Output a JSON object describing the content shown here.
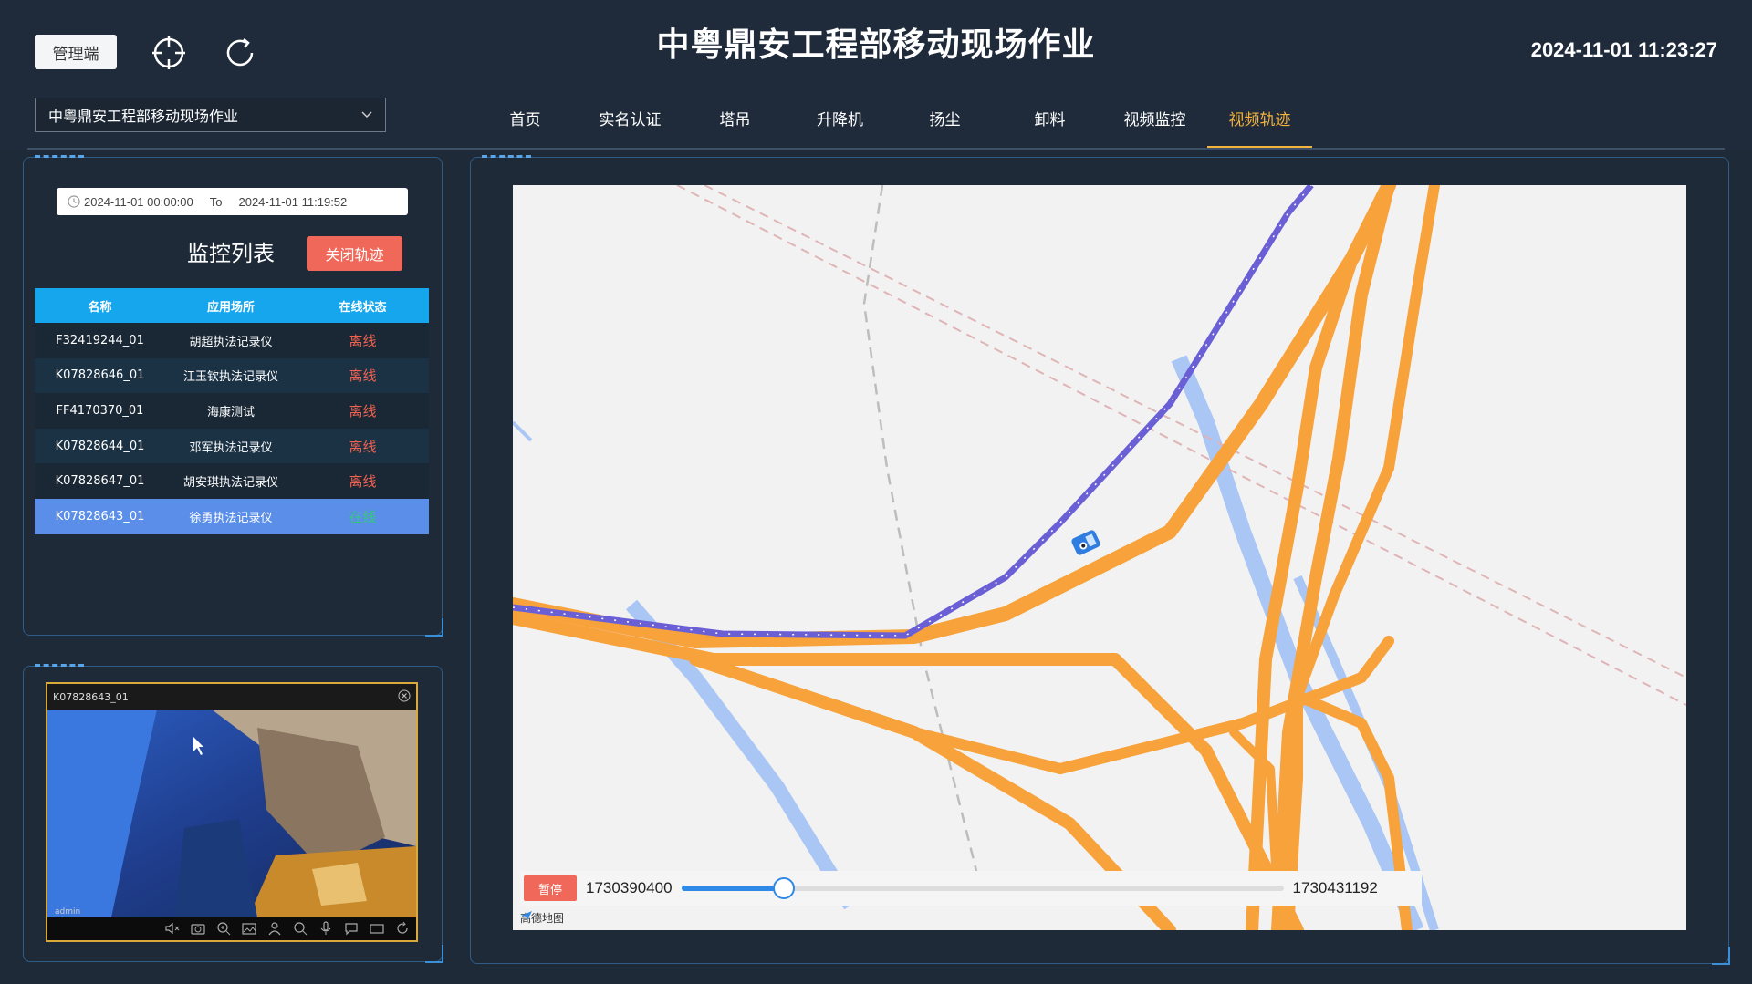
{
  "header": {
    "admin_button": "管理端",
    "title": "中粤鼎安工程部移动现场作业",
    "datetime": "2024-11-01 11:23:27",
    "project_select": "中粤鼎安工程部移动现场作业"
  },
  "nav": [
    {
      "label": "首页",
      "active": false
    },
    {
      "label": "实名认证",
      "active": false
    },
    {
      "label": "塔吊",
      "active": false
    },
    {
      "label": "升降机",
      "active": false
    },
    {
      "label": "扬尘",
      "active": false
    },
    {
      "label": "卸料",
      "active": false
    },
    {
      "label": "视频监控",
      "active": false
    },
    {
      "label": "视频轨迹",
      "active": true
    }
  ],
  "daterange": {
    "start": "2024-11-01 00:00:00",
    "separator": "To",
    "end": "2024-11-01 11:19:52"
  },
  "monitor": {
    "title": "监控列表",
    "close_button": "关闭轨迹",
    "columns": [
      "名称",
      "应用场所",
      "在线状态"
    ],
    "rows": [
      {
        "name": "F32419244_01",
        "place": "胡超执法记录仪",
        "status": "离线",
        "online": false
      },
      {
        "name": "K07828646_01",
        "place": "江玉钦执法记录仪",
        "status": "离线",
        "online": false
      },
      {
        "name": "FF4170370_01",
        "place": "海康测试",
        "status": "离线",
        "online": false
      },
      {
        "name": "K07828644_01",
        "place": "邓军执法记录仪",
        "status": "离线",
        "online": false
      },
      {
        "name": "K07828647_01",
        "place": "胡安琪执法记录仪",
        "status": "离线",
        "online": false
      },
      {
        "name": "K07828643_01",
        "place": "徐勇执法记录仪",
        "status": "在线",
        "online": true
      }
    ]
  },
  "video": {
    "device": "K07828643_01",
    "user_label": "admin"
  },
  "playback": {
    "pause_label": "暂停",
    "start_time": "1730390400",
    "end_time": "1730431192",
    "progress": 0.17
  },
  "map": {
    "brand": "高德地图"
  },
  "colors": {
    "background": "#1e2a38",
    "accent_active": "#f3b33d",
    "table_header": "#15a6ee",
    "offline": "#f0614f",
    "online": "#35c97a",
    "close_button": "#f0685a",
    "road": "#f7a23b",
    "track": "#6b5fd6",
    "water": "#a9c6f5"
  }
}
